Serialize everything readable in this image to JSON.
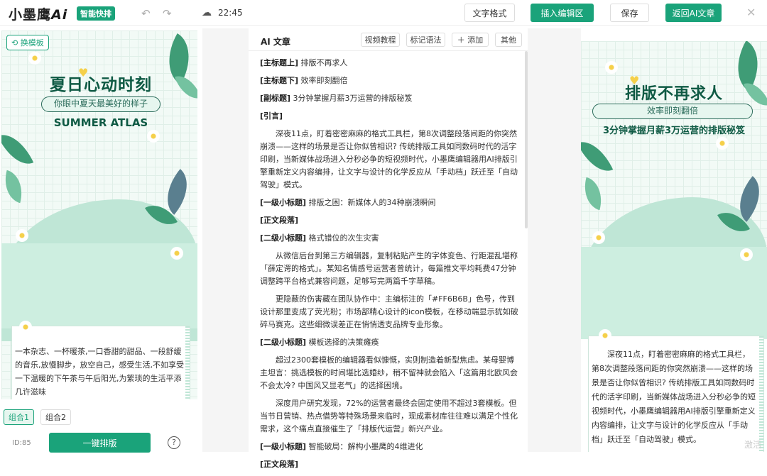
{
  "topbar": {
    "logo_text": "小墨鹰",
    "logo_ai": "Ai",
    "logo_tag": "智能快排",
    "undo_icon": "undo-icon",
    "redo_icon": "redo-icon",
    "cloud_icon": "cloud-saved-icon",
    "save_time": "22:45",
    "text_format": "文字格式",
    "insert_editor": "插入编辑区",
    "save": "保存",
    "back_ai": "返回AI文章",
    "close_icon": "close-icon"
  },
  "left": {
    "swap_template": "换模板",
    "title": "夏日心动时刻",
    "pill": "你眼中夏天最美好的样子",
    "english": "SUMMER ATLAS",
    "box_text": "一本杂志、一杯暖茶,一口香甜的甜品、一段舒缓的音乐,放慢脚步，放空自己，感受生活,不如享受一下温暖的下午茶与午后阳光,为繁琐的生活平添几许滋味",
    "tabs": [
      "组合1",
      "组合2"
    ],
    "id_label": "ID:85",
    "one_key": "一键排版",
    "help_icon": "help-icon"
  },
  "mid": {
    "title": "AI 文章",
    "buttons": [
      "视频教程",
      "标记语法",
      "添加",
      "其他"
    ],
    "paragraphs": [
      {
        "tag": "[主标题上]",
        "text": " 排版不再求人"
      },
      {
        "tag": "[主标题下]",
        "text": " 效率即刻翻倍"
      },
      {
        "tag": "[副标题]",
        "text": " 3分钟掌握月薪3万运营的排版秘笈"
      },
      {
        "tag": "[引言]",
        "text": ""
      },
      {
        "tag": "",
        "text": "深夜11点，盯着密密麻麻的格式工具栏，第8次调整段落间距的你突然崩溃——这样的场景是否让你似曾相识? 传统排版工具如同数码时代的活字印刷，当新媒体战场进入分秒必争的短视频时代，小墨鹰编辑器用AI排版引擎重新定义内容编排，让文字与设计的化学反应从「手动档」跃迁至「自动驾驶」模式。"
      },
      {
        "tag": "[一级小标题]",
        "text": " 排版之困：新媒体人的34种崩溃瞬间"
      },
      {
        "tag": "[正文段落]",
        "text": ""
      },
      {
        "tag": "[二级小标题]",
        "text": " 格式错位的次生灾害"
      },
      {
        "tag": "",
        "text": "从微信后台到第三方编辑器，复制粘贴产生的字体变色、行距混乱堪称「薛定谔的格式」。某知名情感号运营者曾统计，每篇推文平均耗费47分钟调整跨平台格式兼容问题，足够写完两篇千字草稿。"
      },
      {
        "tag": "",
        "text": "更隐蔽的伤害藏在团队协作中：主编标注的「#FF6B6B」色号，传到设计那里变成了荧光粉；市场部精心设计的icon模板，在移动端显示犹如破碎马赛克。这些细微误差正在悄悄透支品牌专业形象。"
      },
      {
        "tag": "[二级小标题]",
        "text": " 模板选择的决策瘫痪"
      },
      {
        "tag": "",
        "text": "超过2300套模板的编辑器看似慷慨，实则制造着新型焦虑。某母婴博主坦言：挑选模板的时间堪比选婚纱，稍不留神就会陷入「这篇用北欧风会不会太冷? 中国风又显老气」的选择困境。"
      },
      {
        "tag": "",
        "text": "深度用户研究发现，72%的运营者最终会固定使用不超过3套模板。但当节日营销、热点借势等特殊场景来临时，现成素材库往往难以满足个性化需求，这个痛点直接催生了「排版代运营」新兴产业。"
      },
      {
        "tag": "[一级小标题]",
        "text": " 智能破局：解构小墨鹰的4维进化"
      },
      {
        "tag": "[正文段落]",
        "text": ""
      }
    ]
  },
  "right": {
    "title": "排版不再求人",
    "pill": "效率即刻翻倍",
    "subtitle": "3分钟掌握月薪3万运营的排版秘笈",
    "box_text": "深夜11点，盯着密密麻麻的格式工具栏，第8次调整段落间距的你突然崩溃——这样的场景是否让你似曾相识? 传统排版工具如同数码时代的活字印刷，当新媒体战场进入分秒必争的短视频时代，小墨鹰编辑器用AI排版引擎重新定义内容编排，让文字与设计的化学反应从「手动档」跃迁至「自动驾驶」模式。",
    "watermark": "激活"
  },
  "colors": {
    "accent": "#1aa37a",
    "dark_green": "#0f5a44",
    "mint": "#bfe6d6"
  }
}
